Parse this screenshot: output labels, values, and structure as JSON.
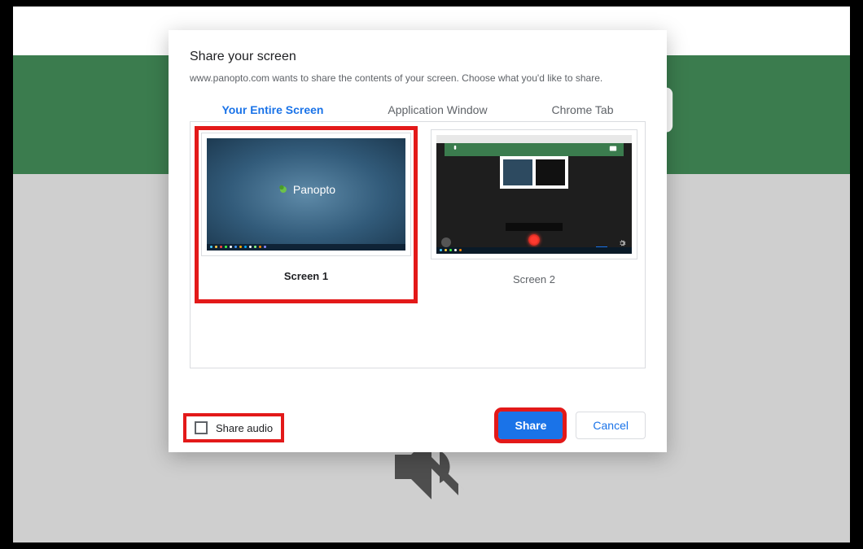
{
  "dialog": {
    "title": "Share your screen",
    "subtitle": "www.panopto.com wants to share the contents of your screen. Choose what you'd like to share.",
    "tabs": {
      "entire": "Your Entire Screen",
      "window": "Application Window",
      "tab": "Chrome Tab"
    },
    "screens": {
      "screen1": {
        "label": "Screen 1",
        "logo_text": "Panopto"
      },
      "screen2": {
        "label": "Screen 2"
      }
    },
    "footer": {
      "share_audio": "Share audio",
      "share": "Share",
      "cancel": "Cancel"
    }
  },
  "colors": {
    "accent": "#1a73e8",
    "highlight": "#e31919",
    "brand_green": "#3b7c4e"
  }
}
